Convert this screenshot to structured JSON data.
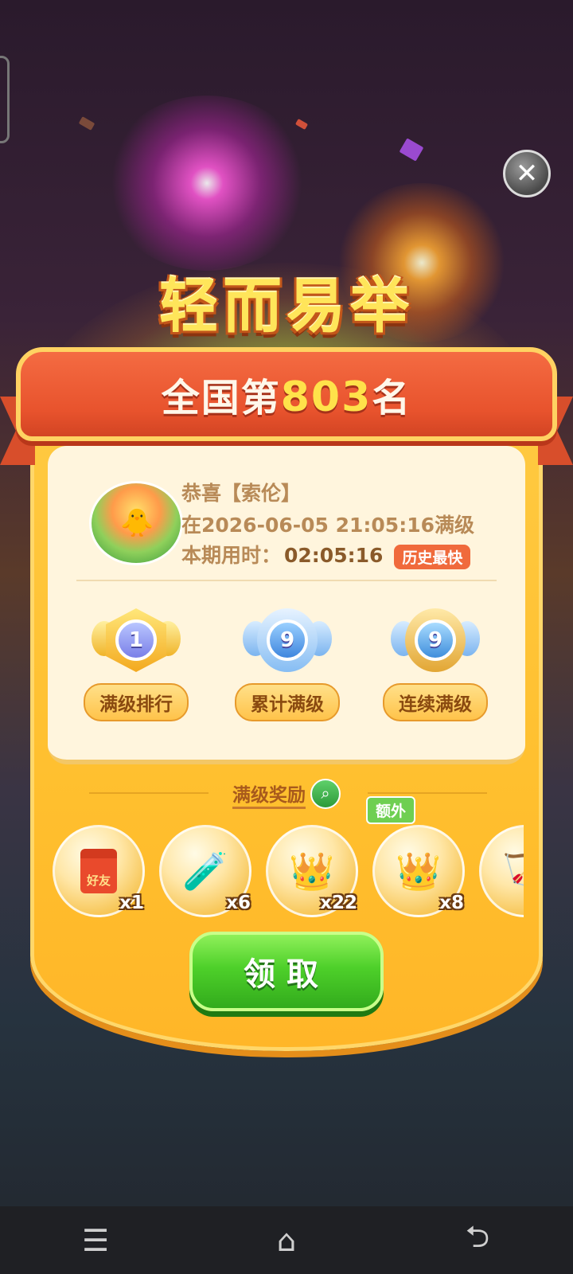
{
  "title": "轻而易举",
  "rank": {
    "prefix": "全国第",
    "number": "803",
    "suffix": "名"
  },
  "congrats": {
    "line1": "恭喜【索伦】",
    "line2": "在2026-06-05 21:05:16满级",
    "time_label": "本期用时：",
    "time_value": "02:05:16",
    "badge": "历史最快"
  },
  "stats": [
    {
      "label": "满级排行",
      "value": "1",
      "icon": "crown-shield-icon"
    },
    {
      "label": "累计满级",
      "value": "9",
      "icon": "winged-medal-icon"
    },
    {
      "label": "连续满级",
      "value": "9",
      "icon": "crowned-medal-icon"
    }
  ],
  "reward_title": "满级奖励",
  "rewards": [
    {
      "name": "red-envelope",
      "label": "好友",
      "qty": "x1"
    },
    {
      "name": "potion",
      "qty": "x6"
    },
    {
      "name": "crown",
      "qty": "x22"
    },
    {
      "name": "crown-extra",
      "qty": "x8",
      "tag": "额外"
    }
  ],
  "claim_label": "领取",
  "close_symbol": "✕",
  "nav": {
    "menu": "☰",
    "home": "⌂",
    "back": "⮌"
  }
}
